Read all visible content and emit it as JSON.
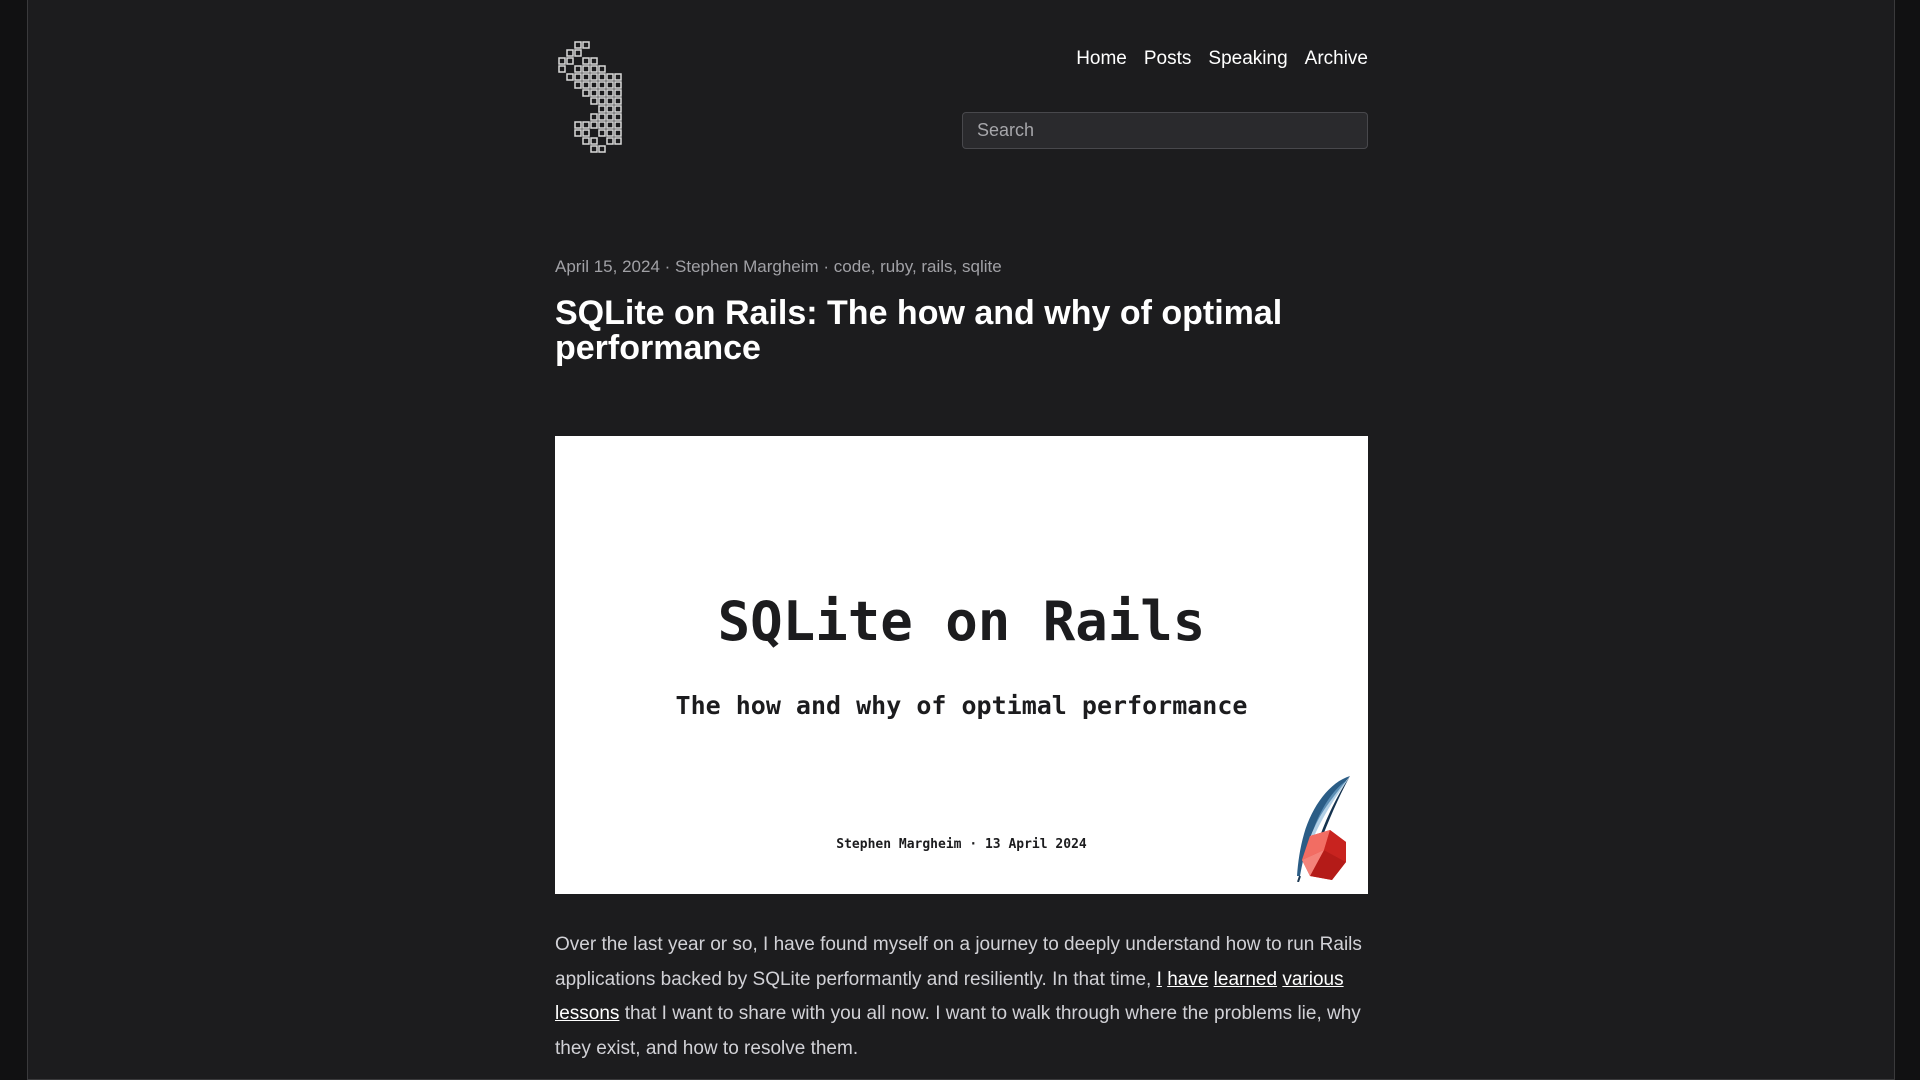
{
  "nav": {
    "items": [
      {
        "label": "Home"
      },
      {
        "label": "Posts"
      },
      {
        "label": "Speaking"
      },
      {
        "label": "Archive"
      }
    ]
  },
  "search": {
    "placeholder": "Search"
  },
  "post": {
    "date": "April 15, 2024",
    "author": "Stephen Margheim",
    "tags": [
      {
        "label": "code"
      },
      {
        "label": "ruby"
      },
      {
        "label": "rails"
      },
      {
        "label": "sqlite"
      }
    ],
    "title": "SQLite on Rails: The how and why of optimal performance",
    "hero": {
      "title": "SQLite on Rails",
      "subtitle": "The how and why of optimal performance",
      "byline": "Stephen Margheim · 13 April 2024"
    },
    "paragraph": {
      "text_before": "Over the last year or so, I have found myself on a journey to deeply understand how to run Rails applications backed by SQLite performantly and resiliently. In that time, ",
      "links": [
        {
          "label": "I"
        },
        {
          "label": "have"
        },
        {
          "label": "learned"
        },
        {
          "label": "various"
        },
        {
          "label": "lessons"
        }
      ],
      "text_after": " that I want to share with you all now. I want to walk through where the problems lie, why they exist, and how to resolve them."
    }
  },
  "colors": {
    "page_background": "#1c1c1e",
    "text_primary": "#ffffff",
    "text_secondary": "#a1a1a6",
    "body_text": "#d1d1d6"
  }
}
